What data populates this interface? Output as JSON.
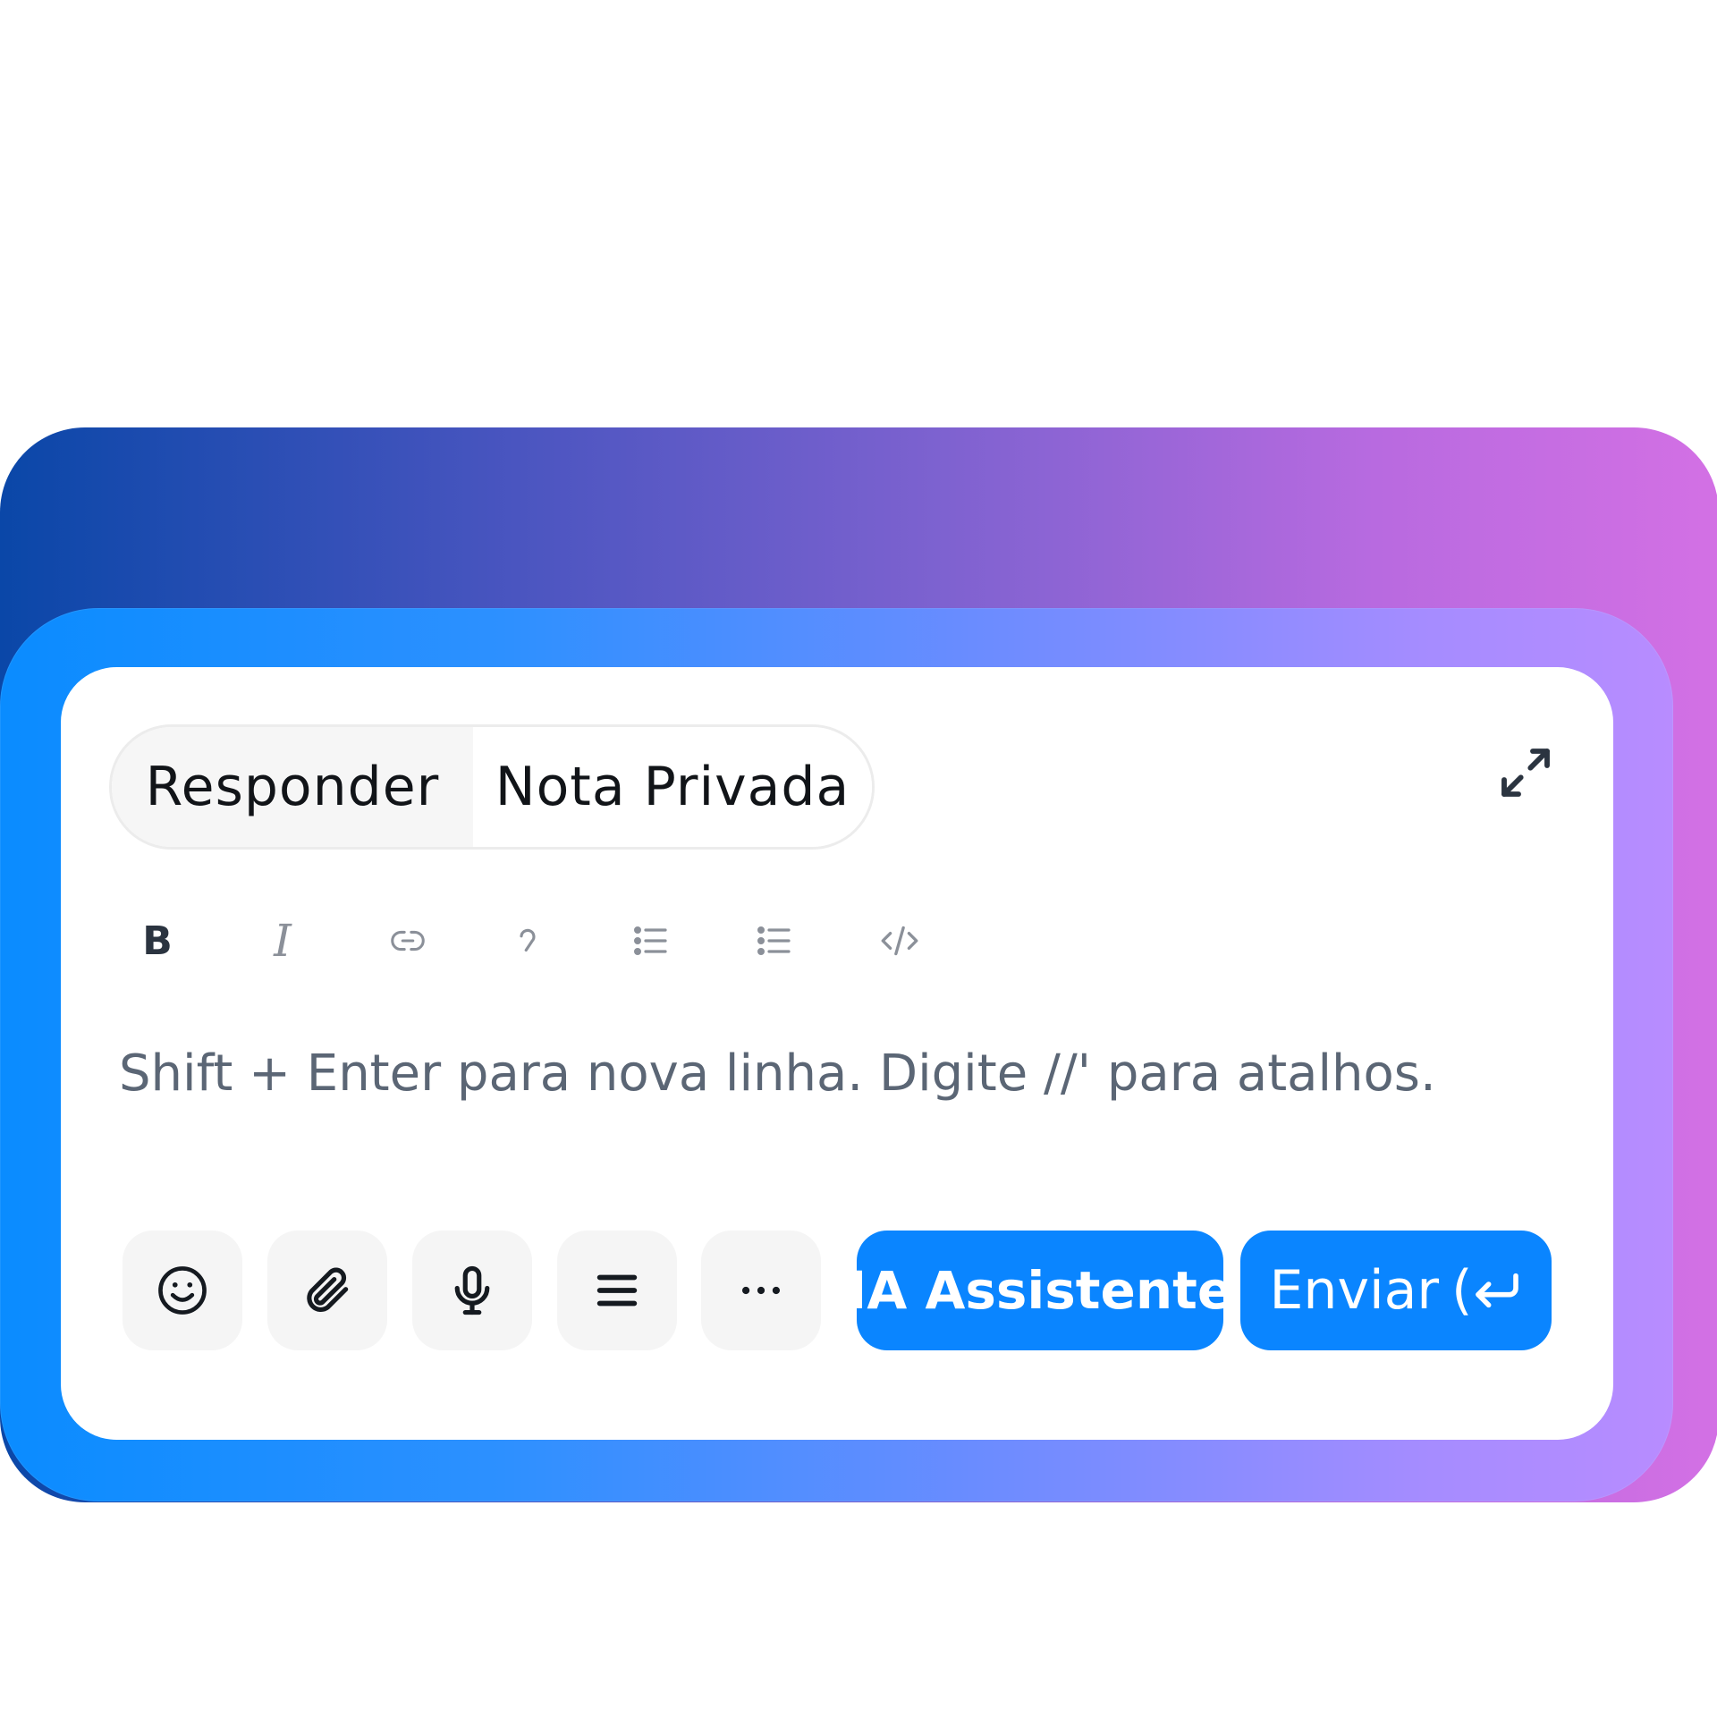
{
  "composer": {
    "tabs": [
      {
        "label": "Responder"
      },
      {
        "label": "Nota Privada"
      }
    ],
    "formatting": {
      "bold": "B",
      "italic": "I"
    },
    "editor": {
      "placeholder": "Shift + Enter para nova linha. Digite //' para atalhos.",
      "value": ""
    },
    "actions": {
      "ai_assistant_label": "IA Assistente",
      "send_label": "Enviar",
      "send_shortcut": "("
    },
    "icons": {
      "expand": "expand-icon",
      "link": "link-icon",
      "quote": "quote-icon",
      "bullet_list": "bullet-list-icon",
      "numbered_list": "list-icon",
      "code": "code-icon",
      "emoji": "emoji-icon",
      "attachment": "paperclip-icon",
      "microphone": "microphone-icon",
      "menu": "menu-icon",
      "more": "more-icon",
      "enter": "enter-icon"
    },
    "colors": {
      "primary": "#0a85ff",
      "gradient_start": "#0a8cff",
      "gradient_end": "#d370e4"
    }
  }
}
